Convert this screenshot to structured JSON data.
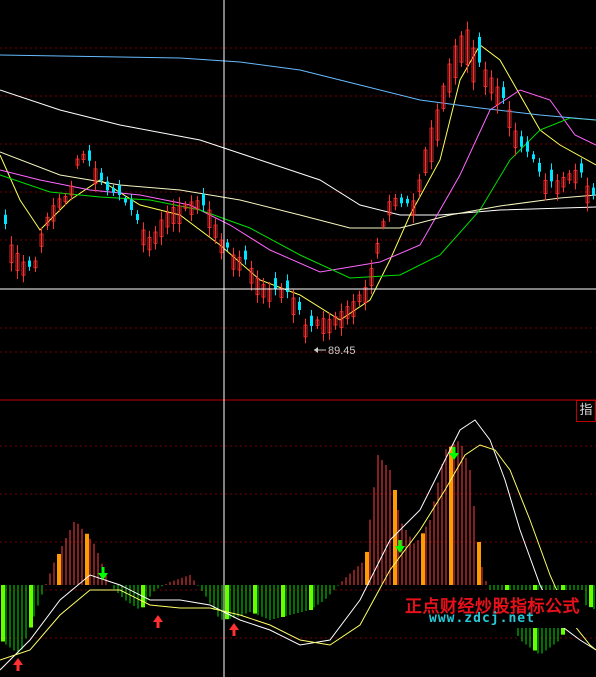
{
  "chart_data": [
    {
      "type": "candlestick",
      "panel": "price",
      "annotations": [
        {
          "text": "89.45",
          "kind": "low-price-marker"
        }
      ],
      "colors": {
        "up": "#ff3030",
        "down": "#00e5ff",
        "crosshair": "#ffffff",
        "grid": "#7a0000"
      },
      "lines": [
        {
          "color": "#ffffff"
        },
        {
          "color": "#ffff55"
        },
        {
          "color": "#ff66ff"
        },
        {
          "color": "#00e000"
        },
        {
          "color": "#f5f5c0"
        },
        {
          "color": "#66bbff"
        }
      ],
      "grid": true
    },
    {
      "type": "bar",
      "panel": "indicator",
      "colors": {
        "positive": "#ff4040",
        "negative": "#00e000",
        "signal_up": "#ff3030",
        "signal_down": "#00ff00",
        "line_fast": "#ffffff",
        "line_slow": "#ffff66"
      },
      "grid": true
    }
  ],
  "ui": {
    "panel_tab": "指",
    "watermark_title": "正点财经炒股指标公式",
    "watermark_url": "www.zdcj.net"
  }
}
